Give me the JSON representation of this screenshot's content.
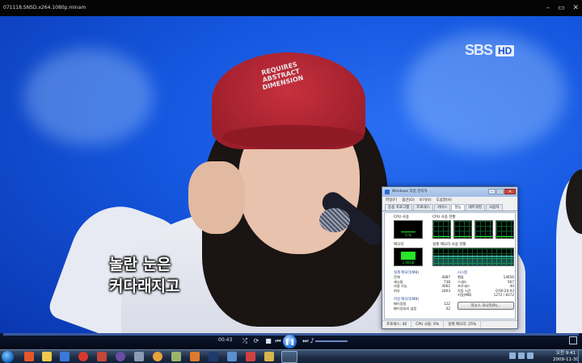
{
  "player": {
    "title": "071118.SNSD.x264.1080p.minam",
    "time": "00:43",
    "progress": 0.0
  },
  "window_controls": {
    "minimize": "–",
    "maximize": "▭",
    "close": "✕"
  },
  "video": {
    "watermark_sbs": "SBS",
    "watermark_hd": "HD",
    "cap_print": [
      "REQUIRES",
      "ABSTRACT",
      "DIMENSION"
    ],
    "subtitle_line1": "놀란 눈은",
    "subtitle_line2": "커다래지고"
  },
  "task_manager": {
    "title": "Windows 작업 관리자",
    "menu": [
      "파일(F)",
      "옵션(O)",
      "보기(V)",
      "도움말(H)"
    ],
    "tabs": [
      "응용 프로그램",
      "프로세스",
      "서비스",
      "성능",
      "네트워킹",
      "사용자"
    ],
    "active_tab": "성능",
    "cpu_usage_label": "CPU 사용",
    "cpu_usage_value": "0 %",
    "cpu_history_label": "CPU 사용 현황",
    "memory_label": "메모리",
    "memory_value": "1.00GB",
    "memory_history_label": "실제 메모리 사용 현황",
    "physical_memory": {
      "title": "실제 메모리(MB)",
      "rows": [
        [
          "전체",
          "4087"
        ],
        [
          "캐시됨",
          "738"
        ],
        [
          "사용 가능",
          "3062"
        ],
        [
          "여유",
          "2403"
        ]
      ]
    },
    "kernel_memory": {
      "title": "커널 메모리(MB)",
      "rows": [
        [
          "페이징됨",
          "122"
        ],
        [
          "페이징되지 않음",
          "42"
        ]
      ]
    },
    "system": {
      "title": "시스템",
      "rows": [
        [
          "핸들",
          "14656"
        ],
        [
          "스레드",
          "567"
        ],
        [
          "프로세스",
          "40"
        ],
        [
          "작동 시간",
          "0:00:20:03"
        ],
        [
          "커밋(MB)",
          "1272 / 8172"
        ]
      ]
    },
    "resource_monitor_button": "리소스 모니터(R)...",
    "status": [
      "프로세스: 40",
      "CPU 사용: 0%",
      "실제 메모리: 25%"
    ]
  },
  "taskbar": {
    "clock_time": "오전 9:41",
    "clock_date": "2009-11-30"
  },
  "colors": {
    "video_blue": "#1456de",
    "cap_red": "#c8303d",
    "meter_green": "#27e527"
  }
}
